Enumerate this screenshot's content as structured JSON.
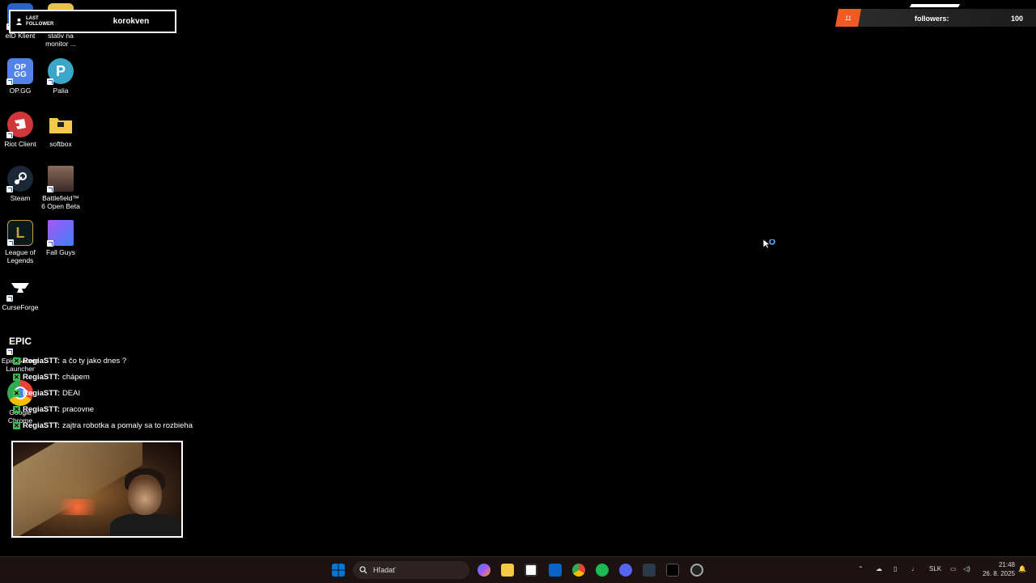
{
  "desktop_icons": [
    {
      "label": "eID Klient",
      "icon": "eid-client-icon",
      "color": "#2a62c8"
    },
    {
      "label": "stativ na monitor ...",
      "icon": "document-icon",
      "color": "#e8c24a"
    },
    {
      "label": "OP.GG",
      "icon": "opgg-icon",
      "color": "#5383e8"
    },
    {
      "label": "Palia",
      "icon": "palia-icon",
      "color": "#3aa6c8"
    },
    {
      "label": "Riot Client",
      "icon": "riot-client-icon",
      "color": "#d13639"
    },
    {
      "label": "softbox",
      "icon": "folder-icon",
      "color": "#f3c948"
    },
    {
      "label": "Steam",
      "icon": "steam-icon",
      "color": "#1b2838"
    },
    {
      "label": "Battlefield™ 6 Open Beta",
      "icon": "battlefield-icon",
      "color": "#6a4a3a"
    },
    {
      "label": "League of Legends",
      "icon": "league-icon",
      "color": "#c89b3c"
    },
    {
      "label": "Fall Guys",
      "icon": "fall-guys-icon",
      "color": "#a855f7"
    },
    {
      "label": "CurseForge",
      "icon": "curseforge-icon",
      "color": "#000000"
    },
    {
      "label": "Epic Games Launcher",
      "icon": "epic-games-icon",
      "color": "#000000"
    },
    {
      "label": "Google Chrome",
      "icon": "chrome-icon",
      "color": "#34a853"
    }
  ],
  "last_follower": {
    "label_line1": "LAST",
    "label_line2": "FOLLOWER",
    "name": "korokven"
  },
  "followers_goal": {
    "current": "11",
    "label": "followers:",
    "target": "100",
    "accent": "#f15a24"
  },
  "chat": [
    {
      "user": "RegiaSTT",
      "message": "a čo ty jako dnes ?"
    },
    {
      "user": "RegiaSTT",
      "message": "chápem"
    },
    {
      "user": "RegiaSTT",
      "message": "DEAI"
    },
    {
      "user": "RegiaSTT",
      "message": "pracovne"
    },
    {
      "user": "RegiaSTT",
      "message": "zajtra robotka a pomaly sa to rozbieha"
    }
  ],
  "taskbar": {
    "search_placeholder": "Hľadať",
    "language": "SLK",
    "time": "21:48",
    "date": "26. 8. 2025",
    "colors": {
      "start": "#0078d4",
      "bg": "#1c1212"
    }
  }
}
